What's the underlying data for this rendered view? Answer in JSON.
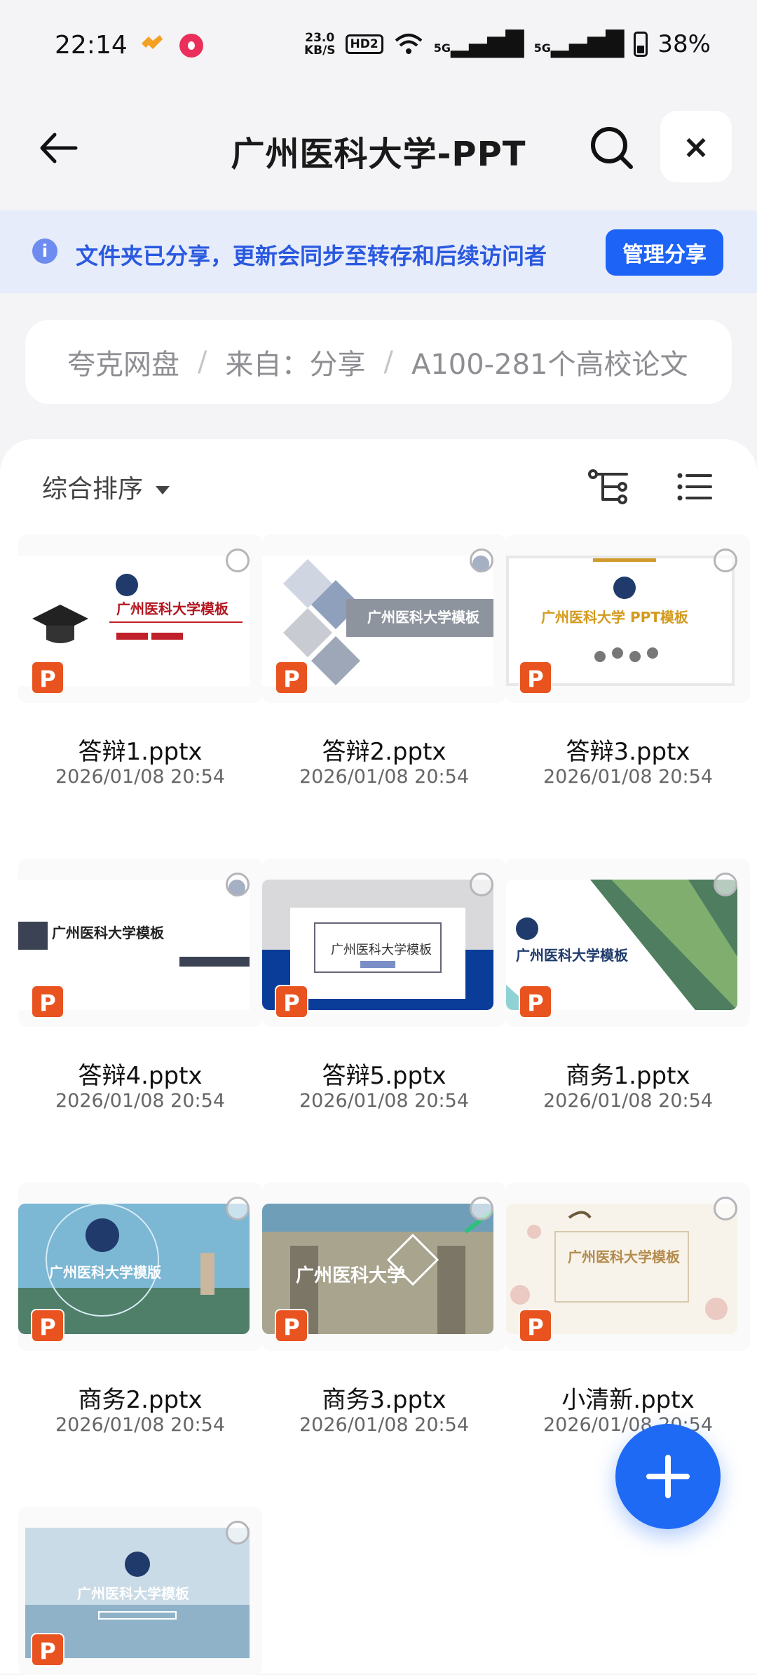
{
  "status_bar": {
    "time": "22:14",
    "net_speed": "23.0",
    "net_unit": "KB/S",
    "hd_label": "HD2",
    "signal1": "5G",
    "signal2": "5G",
    "battery": "38%"
  },
  "header": {
    "title": "广州医科大学-PPT",
    "close_icon": "×"
  },
  "banner": {
    "info_glyph": "i",
    "text": "文件夹已分享，更新会同步至转存和后续访问者",
    "button": "管理分享"
  },
  "breadcrumb": [
    "夸克网盘",
    "来自：分享",
    "A100-281个高校论文"
  ],
  "toolbar": {
    "sort_label": "综合排序"
  },
  "files": [
    {
      "name": "答辩1.pptx",
      "date": "2026/01/08 20:54",
      "slide_text": "广州医科大学模板"
    },
    {
      "name": "答辩2.pptx",
      "date": "2026/01/08 20:54",
      "slide_text": "广州医科大学模板"
    },
    {
      "name": "答辩3.pptx",
      "date": "2026/01/08 20:54",
      "slide_text": "广州医科大学 PPT模板"
    },
    {
      "name": "答辩4.pptx",
      "date": "2026/01/08 20:54",
      "slide_text": "广州医科大学模板"
    },
    {
      "name": "答辩5.pptx",
      "date": "2026/01/08 20:54",
      "slide_text": "广州医科大学模板"
    },
    {
      "name": "商务1.pptx",
      "date": "2026/01/08 20:54",
      "slide_text": "广州医科大学模板"
    },
    {
      "name": "商务2.pptx",
      "date": "2026/01/08 20:54",
      "slide_text": "广州医科大学模版"
    },
    {
      "name": "商务3.pptx",
      "date": "2026/01/08 20:54",
      "slide_text": "广州医科大学"
    },
    {
      "name": "小清新.pptx",
      "date": "2026/01/08 20:54",
      "slide_text": "广州医科大学模板"
    },
    {
      "name": "",
      "date": "",
      "slide_text": "广州医科大学模板"
    }
  ],
  "file_badge": "P",
  "colors": {
    "accent": "#1d63f6",
    "banner_bg": "#e7ecfb",
    "ppt_badge": "#e9531f"
  }
}
